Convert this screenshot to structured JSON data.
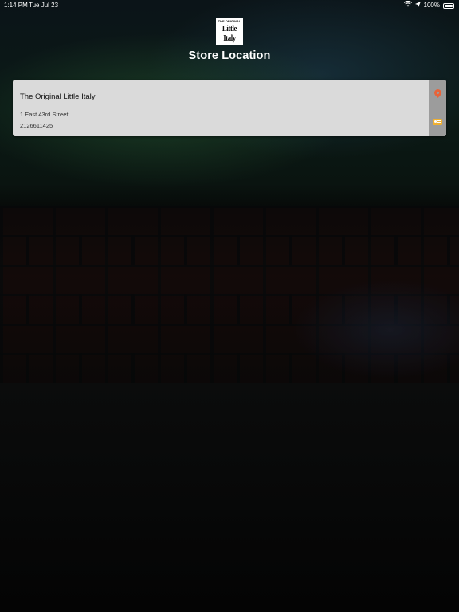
{
  "status_bar": {
    "time": "1:14 PM",
    "date": "Tue Jul 23",
    "battery": "100%",
    "icons": [
      "wifi-icon",
      "location-arrow-icon",
      "battery-icon"
    ]
  },
  "logo": {
    "small_text": "THE ORIGINAL",
    "main_text": "Little Italy"
  },
  "header": {
    "title": "Store Location"
  },
  "store": {
    "name": "The Original Little Italy",
    "address": "1 East 43rd Street",
    "phone": "2126611425",
    "actions": [
      "map-pin-icon",
      "call-icon"
    ]
  },
  "colors": {
    "card_background": "#dadada",
    "action_strip": "#9c9c9c",
    "map_pin": "#e8643a",
    "call": "#f0b030"
  }
}
